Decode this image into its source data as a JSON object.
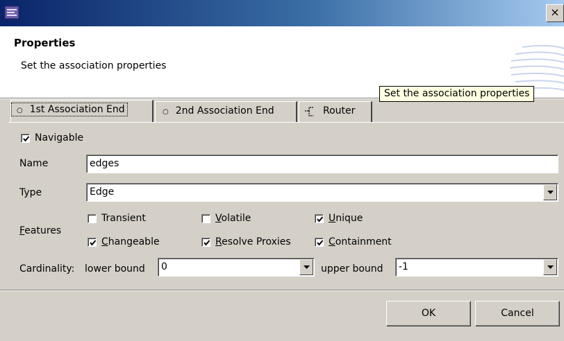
{
  "header": {
    "title": "Properties",
    "description": "Set the association properties"
  },
  "tooltip": {
    "text": "Set the association properties"
  },
  "tabs": [
    {
      "label": "1st Association End",
      "selected": true
    },
    {
      "label": "2nd Association End",
      "selected": false
    },
    {
      "label": "Router",
      "selected": false
    }
  ],
  "navigable": {
    "label": "Navigable",
    "checked": true
  },
  "name_field": {
    "label": "Name",
    "value": "edges"
  },
  "type_field": {
    "label": "Type",
    "value": "Edge"
  },
  "features": {
    "label": "Features",
    "label_mnemonic": "F",
    "label_rest": "eatures",
    "items": [
      {
        "label": "Transient",
        "mnemonic": "",
        "rest": "Transient",
        "checked": false
      },
      {
        "label": "Volatile",
        "mnemonic": "V",
        "rest": "olatile",
        "checked": false
      },
      {
        "label": "Unique",
        "mnemonic": "U",
        "rest": "nique",
        "checked": true
      },
      {
        "label": "Changeable",
        "mnemonic": "C",
        "rest": "hangeable",
        "checked": true
      },
      {
        "label": "Resolve Proxies",
        "mnemonic": "R",
        "rest": "esolve Proxies",
        "checked": true
      },
      {
        "label": "Containment",
        "mnemonic": "C",
        "rest": "ontainment",
        "checked": true
      }
    ]
  },
  "cardinality": {
    "label": "Cardinality:",
    "lower_label": "lower bound",
    "lower_value": "0",
    "upper_label": "upper bound",
    "upper_value": "-1"
  },
  "buttons": {
    "ok": "OK",
    "cancel": "Cancel"
  },
  "window": {
    "close_glyph": "×"
  },
  "colors": {
    "titlebar_start": "#0a246a",
    "titlebar_end": "#a6caf0",
    "dialog_bg": "#d4d0c8",
    "tooltip_bg": "#ffffe1"
  }
}
